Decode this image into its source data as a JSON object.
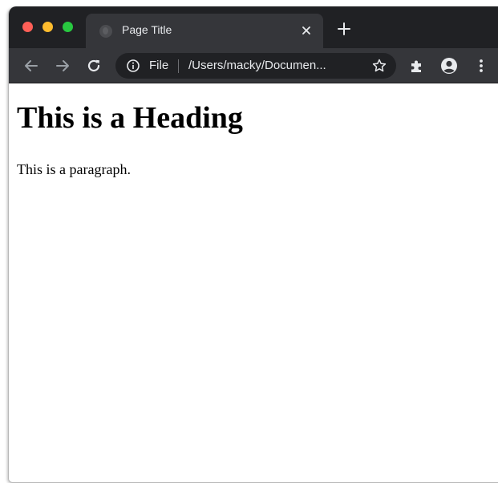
{
  "browser": {
    "window_controls": [
      {
        "name": "close",
        "color": "#ff5f57"
      },
      {
        "name": "minimize",
        "color": "#febc2e"
      },
      {
        "name": "zoom",
        "color": "#28c840"
      }
    ],
    "tabs": [
      {
        "title": "Page Title",
        "favicon": "globe-icon",
        "active": true,
        "close_icon": "close-icon"
      }
    ],
    "new_tab_icon": "plus-icon",
    "toolbar": {
      "back_icon": "arrow-left-icon",
      "forward_icon": "arrow-right-icon",
      "reload_icon": "reload-icon",
      "omnibox": {
        "security_icon": "info-icon",
        "scheme_label": "File",
        "url": "/Users/macky/Documen...",
        "bookmark_icon": "star-icon"
      },
      "extensions_icon": "puzzle-icon",
      "account_icon": "account-icon",
      "menu_icon": "kebab-menu-icon"
    },
    "colors": {
      "tabstrip_bg": "#202124",
      "toolbar_bg": "#35363a",
      "text_light": "#e8eaed",
      "icon_disabled": "#9aa0a6"
    }
  },
  "page": {
    "heading": "This is a Heading",
    "paragraph": "This is a paragraph."
  }
}
